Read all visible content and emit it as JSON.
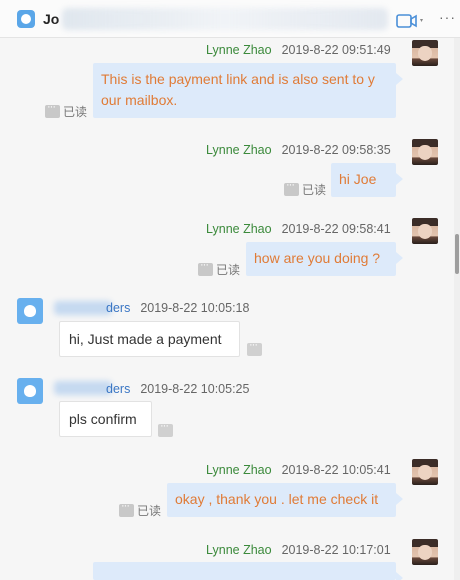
{
  "header": {
    "title": "Jo"
  },
  "read_label": "已读",
  "messages": [
    {
      "sender": "Lynne Zhao",
      "time": "2019-8-22 09:51:49",
      "text_line1": "This is the payment link and is also sent to y",
      "text_line2": "our mailbox."
    },
    {
      "sender": "Lynne Zhao",
      "time": "2019-8-22 09:58:35",
      "text": "hi Joe"
    },
    {
      "sender": "Lynne Zhao",
      "time": "2019-8-22 09:58:41",
      "text": "how are you doing  ?"
    },
    {
      "sender": "ders",
      "time": "2019-8-22 10:05:18",
      "text": "hi, Just made a payment"
    },
    {
      "sender": "ders",
      "time": "2019-8-22 10:05:25",
      "text": "pls confirm"
    },
    {
      "sender": "Lynne Zhao",
      "time": "2019-8-22 10:05:41",
      "text": "okay , thank you . let me check it"
    },
    {
      "sender": "Lynne Zhao",
      "time": "2019-8-22 10:17:01",
      "text": ""
    }
  ],
  "colors": {
    "outgoing_bubble": "#ddeafa",
    "outgoing_text": "#e07b36",
    "own_name": "#3b8a3b",
    "other_name": "#3a76c4"
  }
}
